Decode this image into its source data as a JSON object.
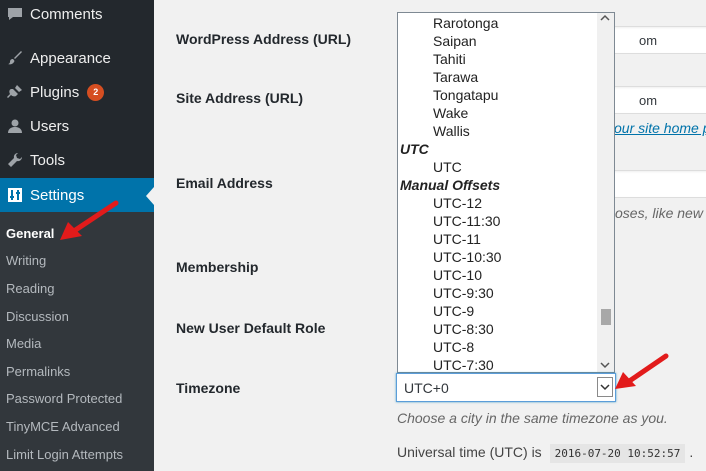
{
  "sidebar": {
    "items": [
      {
        "label": "Comments",
        "icon": "comments-icon"
      },
      {
        "label": "Appearance",
        "icon": "paintbrush-icon"
      },
      {
        "label": "Plugins",
        "icon": "plug-icon",
        "badge": "2"
      },
      {
        "label": "Users",
        "icon": "user-icon"
      },
      {
        "label": "Tools",
        "icon": "wrench-icon"
      },
      {
        "label": "Settings",
        "icon": "settings-sliders-icon"
      }
    ],
    "submenu": [
      "General",
      "Writing",
      "Reading",
      "Discussion",
      "Media",
      "Permalinks",
      "Password Protected",
      "TinyMCE Advanced",
      "Limit Login Attempts"
    ]
  },
  "form": {
    "wp_address_label": "WordPress Address (URL)",
    "wp_address_value": "om",
    "site_address_label": "Site Address (URL)",
    "site_address_value": "om",
    "site_address_desc_link": "our site home p",
    "email_label": "Email Address",
    "email_desc": "oses, like new u",
    "membership_label": "Membership",
    "default_role_label": "New User Default Role",
    "timezone_label": "Timezone",
    "timezone_value": "UTC+0",
    "timezone_desc": "Choose a city in the same timezone as you.",
    "utc_prefix": "Universal time (UTC) is",
    "utc_time": "2016-07-20 10:52:57",
    "utc_suffix": "."
  },
  "dropdown": {
    "options_top": [
      "Rarotonga",
      "Saipan",
      "Tahiti",
      "Tarawa",
      "Tongatapu",
      "Wake",
      "Wallis"
    ],
    "group_utc": "UTC",
    "utc_option": "UTC",
    "group_manual": "Manual Offsets",
    "manual_options": [
      "UTC-12",
      "UTC-11:30",
      "UTC-11",
      "UTC-10:30",
      "UTC-10",
      "UTC-9:30",
      "UTC-9",
      "UTC-8:30",
      "UTC-8",
      "UTC-7:30"
    ]
  },
  "colors": {
    "sidebar_bg": "#23282d",
    "active_bg": "#0073aa",
    "badge_bg": "#d54e21",
    "annotation_red": "#e21b1b"
  }
}
